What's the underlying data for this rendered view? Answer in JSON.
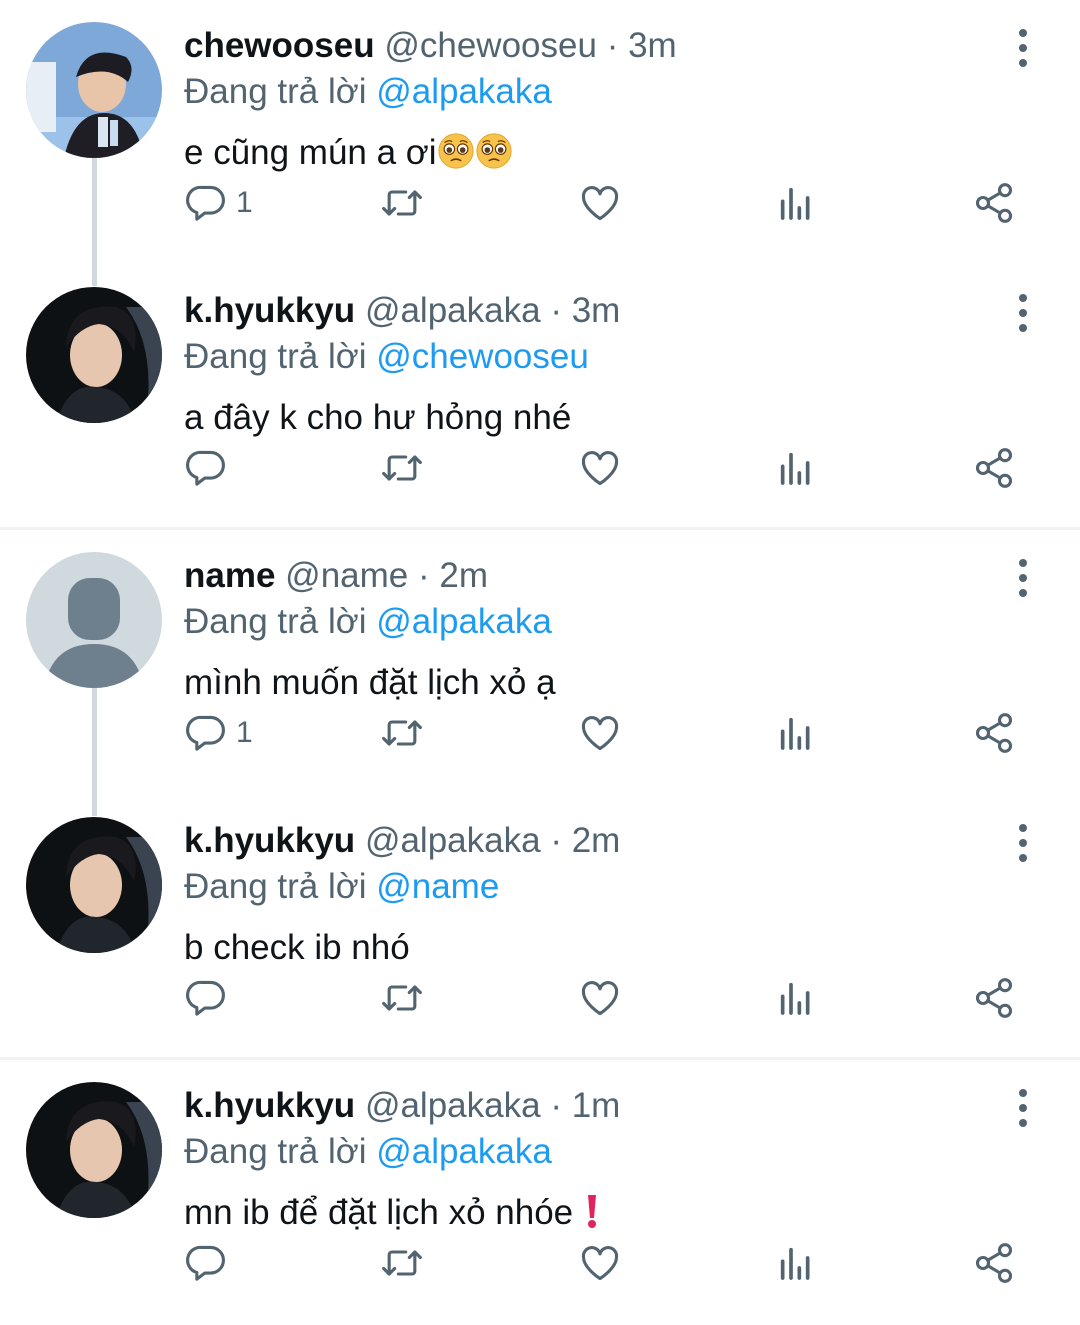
{
  "tweets": [
    {
      "name": "chewooseu",
      "handle": "@chewooseu",
      "time": "· 3m",
      "reply_prefix": "Đang trả lời",
      "reply_to": "@alpakaka",
      "text": "e cũng mún a ơi",
      "text_emoji": [
        "pleading-face-emoji",
        "pleading-face-emoji"
      ],
      "reply_count": "1",
      "avatar": "photo-avatar-chewooseu"
    },
    {
      "name": "k.hyukkyu",
      "handle": "@alpakaka",
      "time": "· 3m",
      "reply_prefix": "Đang trả lời",
      "reply_to": "@chewooseu",
      "text": "a đây k cho hư hỏng nhé",
      "reply_count": "",
      "avatar": "photo-avatar-khyukkyu"
    },
    {
      "name": "name",
      "handle": "@name",
      "time": "· 2m",
      "reply_prefix": "Đang trả lời",
      "reply_to": "@alpakaka",
      "text": "mình muốn đặt lịch xỏ ạ",
      "reply_count": "1",
      "avatar": "default-avatar"
    },
    {
      "name": "k.hyukkyu",
      "handle": "@alpakaka",
      "time": "· 2m",
      "reply_prefix": "Đang trả lời",
      "reply_to": "@name",
      "text": "b check ib nhó",
      "reply_count": "",
      "avatar": "photo-avatar-khyukkyu"
    },
    {
      "name": "k.hyukkyu",
      "handle": "@alpakaka",
      "time": "· 1m",
      "reply_prefix": "Đang trả lời",
      "reply_to": "@alpakaka",
      "text": "mn ib để đặt lịch xỏ nhóe",
      "text_emoji": [
        "exclamation-emoji"
      ],
      "reply_count": "",
      "avatar": "photo-avatar-khyukkyu"
    }
  ],
  "colors": {
    "mention": "#1d9bf0",
    "secondary": "#536471",
    "thread_line": "#cfd9de",
    "exclamation": "#e0245e"
  },
  "icons": [
    "reply-icon",
    "retweet-icon",
    "like-icon",
    "analytics-icon",
    "share-icon",
    "more-icon"
  ]
}
